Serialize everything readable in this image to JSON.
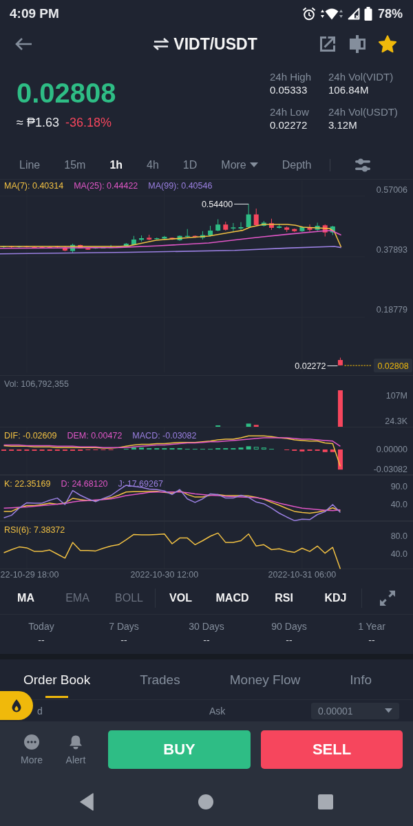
{
  "status_bar": {
    "time": "4:09 PM",
    "battery": "78%"
  },
  "header": {
    "pair": "VIDT/USDT",
    "favorite": true
  },
  "ticker": {
    "price": "0.02808",
    "fiat": "≈ ₱1.63",
    "change": "-36.18%",
    "stats": [
      {
        "label": "24h High",
        "value": "0.05333"
      },
      {
        "label": "24h Vol(VIDT)",
        "value": "106.84M"
      },
      {
        "label": "24h Low",
        "value": "0.02272"
      },
      {
        "label": "24h Vol(USDT)",
        "value": "3.12M"
      }
    ]
  },
  "intervals": [
    {
      "label": "Line",
      "kind": "tab",
      "selected": false
    },
    {
      "label": "15m",
      "kind": "tab",
      "selected": false
    },
    {
      "label": "1h",
      "kind": "tab",
      "selected": true
    },
    {
      "label": "4h",
      "kind": "tab",
      "selected": false
    },
    {
      "label": "1D",
      "kind": "tab",
      "selected": false
    },
    {
      "label": "More",
      "kind": "dropdown",
      "selected": false
    },
    {
      "label": "Depth",
      "kind": "tab",
      "selected": false
    }
  ],
  "price_chart": {
    "legend": [
      {
        "label": "MA(7): 0.40314",
        "color": "#f3c243"
      },
      {
        "label": "MA(25): 0.44422",
        "color": "#e257c8"
      },
      {
        "label": "MA(99): 0.40546",
        "color": "#9b80e2"
      }
    ],
    "axis_labels": [
      "0.57006",
      "0.37893",
      "0.18779"
    ],
    "high_label": "0.54400",
    "low_label": "0.02272",
    "last_price": "0.02808"
  },
  "volume_chart": {
    "legend": "Vol: 106,792,355",
    "axis_labels": [
      "107M",
      "24.3K"
    ]
  },
  "macd_chart": {
    "chart_data": {
      "type": "line",
      "categories": [
        null,
        null,
        null,
        null,
        null,
        null,
        null,
        null,
        null,
        null,
        null,
        null,
        null,
        null,
        null,
        null,
        null,
        null,
        null,
        null,
        null,
        null,
        null,
        null,
        null,
        null,
        null,
        null,
        null,
        null,
        null,
        null,
        null,
        null,
        null,
        null,
        null,
        null,
        null,
        null,
        null,
        null,
        null,
        null,
        null
      ],
      "series": [
        {
          "name": "DIF: -0.02609",
          "color": "#f3c243",
          "values": [
            0.006,
            0.005,
            0.005,
            0.005,
            0.004,
            0.004,
            0.004,
            0.003,
            0.003,
            0.003,
            0.003,
            0.003,
            0.003,
            0.002,
            0.002,
            0.003,
            0.005,
            0.007,
            0.008,
            0.008,
            0.009,
            0.009,
            0.01,
            0.011,
            0.011,
            0.011,
            0.012,
            0.013,
            0.015,
            0.016,
            0.016,
            0.018,
            0.021,
            0.021,
            0.021,
            0.02,
            0.018,
            0.017,
            0.015,
            0.014,
            0.013,
            0.013,
            0.01,
            0.009,
            -0.026
          ]
        },
        {
          "name": "DEM: 0.00472",
          "color": "#e257c8",
          "values": [
            0.007,
            0.007,
            0.007,
            0.006,
            0.006,
            0.006,
            0.006,
            0.005,
            0.005,
            0.005,
            0.004,
            0.004,
            0.004,
            0.003,
            0.003,
            0.003,
            0.003,
            0.004,
            0.005,
            0.006,
            0.007,
            0.007,
            0.008,
            0.009,
            0.01,
            0.01,
            0.011,
            0.012,
            0.012,
            0.013,
            0.014,
            0.015,
            0.016,
            0.017,
            0.018,
            0.018,
            0.018,
            0.018,
            0.017,
            0.016,
            0.016,
            0.015,
            0.014,
            0.013,
            0.005
          ]
        },
        {
          "type": "bar",
          "values": [
            -0.002,
            -0.002,
            -0.002,
            -0.002,
            -0.002,
            -0.002,
            -0.002,
            -0.002,
            -0.002,
            -0.002,
            -0.002,
            -0.001,
            -0.001,
            -0.001,
            -0.001,
            0,
            0.001,
            0.003,
            0.003,
            0.002,
            0.002,
            0.002,
            0.002,
            0.002,
            0.001,
            0.001,
            0.001,
            0.001,
            0.002,
            0.002,
            0.002,
            0.003,
            0.005,
            0.004,
            0.003,
            0.001,
            0,
            -0.001,
            -0.002,
            -0.003,
            -0.002,
            -0.002,
            -0.004,
            -0.004,
            -0.031
          ],
          "colors": [
            "#f6465d",
            "#f6465d",
            "#f6465d",
            "#f6465d",
            "#f6465d",
            "#f6465d",
            "#f6465d",
            "#f6465d",
            "#f6465d",
            "#f6465d",
            "#f6465d",
            "#f6465d",
            "#f6465d",
            "#f6465d",
            "#f6465d",
            null,
            "#2ebd85",
            "#2ebd85",
            "#2ebd85",
            "#2ebd85",
            "#2ebd85",
            "#2ebd85",
            "#2ebd85",
            "#2ebd85",
            "#2ebd85",
            "#2ebd85",
            "#2ebd85",
            "#2ebd85",
            "#2ebd85",
            "#2ebd85",
            "#2ebd85",
            "#2ebd85",
            "#2ebd85",
            "#2ebd85",
            "#2ebd85",
            "#2ebd85",
            null,
            "#f6465d",
            "#f6465d",
            "#f6465d",
            "#f6465d",
            "#f6465d",
            "#f6465d",
            "#f6465d",
            "#f6465d"
          ]
        }
      ],
      "ylim": [
        -0.0393,
        0.0351
      ],
      "yticks": [
        {
          "value": 0,
          "label": "0.00000"
        },
        {
          "value": -0.03082,
          "label": "-0.03082"
        }
      ]
    },
    "histogram_label": {
      "label": "MACD: -0.03082",
      "color": "#9b80e2"
    }
  },
  "kdj_chart": {
    "chart_data": {
      "type": "line",
      "categories": [
        null,
        null,
        null,
        null,
        null,
        null,
        null,
        null,
        null,
        null,
        null,
        null,
        null,
        null,
        null,
        null,
        null,
        null,
        null,
        null,
        null,
        null,
        null,
        null,
        null,
        null,
        null,
        null,
        null,
        null,
        null,
        null,
        null,
        null,
        null,
        null,
        null,
        null,
        null,
        null,
        null,
        null,
        null,
        null,
        null
      ],
      "series": [
        {
          "name": "K: 22.35169",
          "color": "#f3c243",
          "values": [
            21,
            21,
            31,
            37,
            37,
            40,
            44,
            41,
            45,
            57,
            54,
            51,
            51,
            55,
            59,
            66,
            75,
            76,
            76,
            77,
            77,
            74,
            72,
            79,
            68,
            61,
            61,
            66,
            68,
            65,
            65,
            65,
            64,
            60,
            55,
            46,
            38,
            29,
            21,
            18,
            16,
            19,
            23,
            31,
            22
          ]
        },
        {
          "name": "D: 24.68120",
          "color": "#e257c8",
          "values": [
            30,
            31,
            32,
            33,
            35,
            37,
            39,
            41,
            43,
            47,
            50,
            51,
            53,
            54,
            56,
            60,
            65,
            68,
            71,
            74,
            75,
            75,
            75,
            75,
            73,
            70,
            68,
            66,
            65,
            63,
            62,
            61,
            60,
            59,
            56,
            50,
            44,
            39,
            34,
            30,
            28,
            26,
            24,
            23,
            25
          ]
        },
        {
          "name": "J: 17.69267",
          "color": "#9b80e2",
          "values": [
            3,
            10,
            30,
            45,
            44,
            44,
            52,
            58,
            40,
            79,
            66,
            56,
            48,
            57,
            65,
            80,
            94,
            91,
            88,
            83,
            82,
            78,
            68,
            82,
            56,
            46,
            56,
            70,
            68,
            58,
            58,
            66,
            60,
            47,
            42,
            30,
            16,
            5,
            -5,
            -1,
            -2,
            12,
            20,
            40,
            18
          ]
        }
      ],
      "ylim": [
        -6.2,
        122.7
      ],
      "yticks": [
        {
          "value": 90,
          "label": "90.0"
        },
        {
          "value": 40,
          "label": "40.0"
        }
      ]
    }
  },
  "rsi_chart": {
    "chart_data": {
      "type": "line",
      "categories": [
        null,
        null,
        null,
        "22-10-29 18:00",
        null,
        null,
        null,
        null,
        null,
        null,
        null,
        null,
        null,
        null,
        null,
        null,
        null,
        null,
        null,
        null,
        null,
        "2022-10-30 12:00",
        null,
        null,
        null,
        null,
        null,
        null,
        null,
        null,
        null,
        null,
        null,
        null,
        null,
        null,
        null,
        null,
        null,
        "2022-10-31 06:00",
        null,
        null,
        null,
        null,
        null
      ],
      "series": [
        {
          "name": "RSI(6): 7.38372",
          "color": "#f3c243",
          "values": [
            43,
            50,
            56,
            54,
            46,
            46,
            49,
            40,
            31,
            66,
            48,
            48,
            47,
            53,
            58,
            61,
            72,
            84,
            83,
            83,
            84,
            85,
            63,
            76,
            76,
            61,
            70,
            80,
            87,
            66,
            66,
            70,
            85,
            58,
            61,
            50,
            52,
            47,
            44,
            53,
            46,
            58,
            42,
            55,
            7
          ]
        }
      ],
      "ylim": [
        6.1,
        113.8
      ],
      "yticks": [
        {
          "value": 80,
          "label": "80.0"
        },
        {
          "value": 40,
          "label": "40.0"
        }
      ]
    }
  },
  "indicators": {
    "main": [
      {
        "label": "MA",
        "selected": true
      },
      {
        "label": "EMA",
        "selected": false
      },
      {
        "label": "BOLL",
        "selected": false
      }
    ],
    "sub": [
      {
        "label": "VOL",
        "selected": true
      },
      {
        "label": "MACD",
        "selected": true
      },
      {
        "label": "RSI",
        "selected": true
      },
      {
        "label": "KDJ",
        "selected": true
      }
    ]
  },
  "performance": [
    {
      "label": "Today",
      "value": "--"
    },
    {
      "label": "7 Days",
      "value": "--"
    },
    {
      "label": "30 Days",
      "value": "--"
    },
    {
      "label": "90 Days",
      "value": "--"
    },
    {
      "label": "1 Year",
      "value": "--"
    }
  ],
  "section_tabs": [
    {
      "label": "Order Book",
      "selected": true
    },
    {
      "label": "Trades",
      "selected": false
    },
    {
      "label": "Money Flow",
      "selected": false
    },
    {
      "label": "Info",
      "selected": false
    }
  ],
  "order_book": {
    "column_1": "d",
    "column_2": "Ask",
    "precision": "0.00001"
  },
  "bottom_bar": {
    "actions": [
      {
        "label": "More"
      },
      {
        "label": "Alert"
      }
    ],
    "buy_label": "BUY",
    "sell_label": "SELL"
  }
}
